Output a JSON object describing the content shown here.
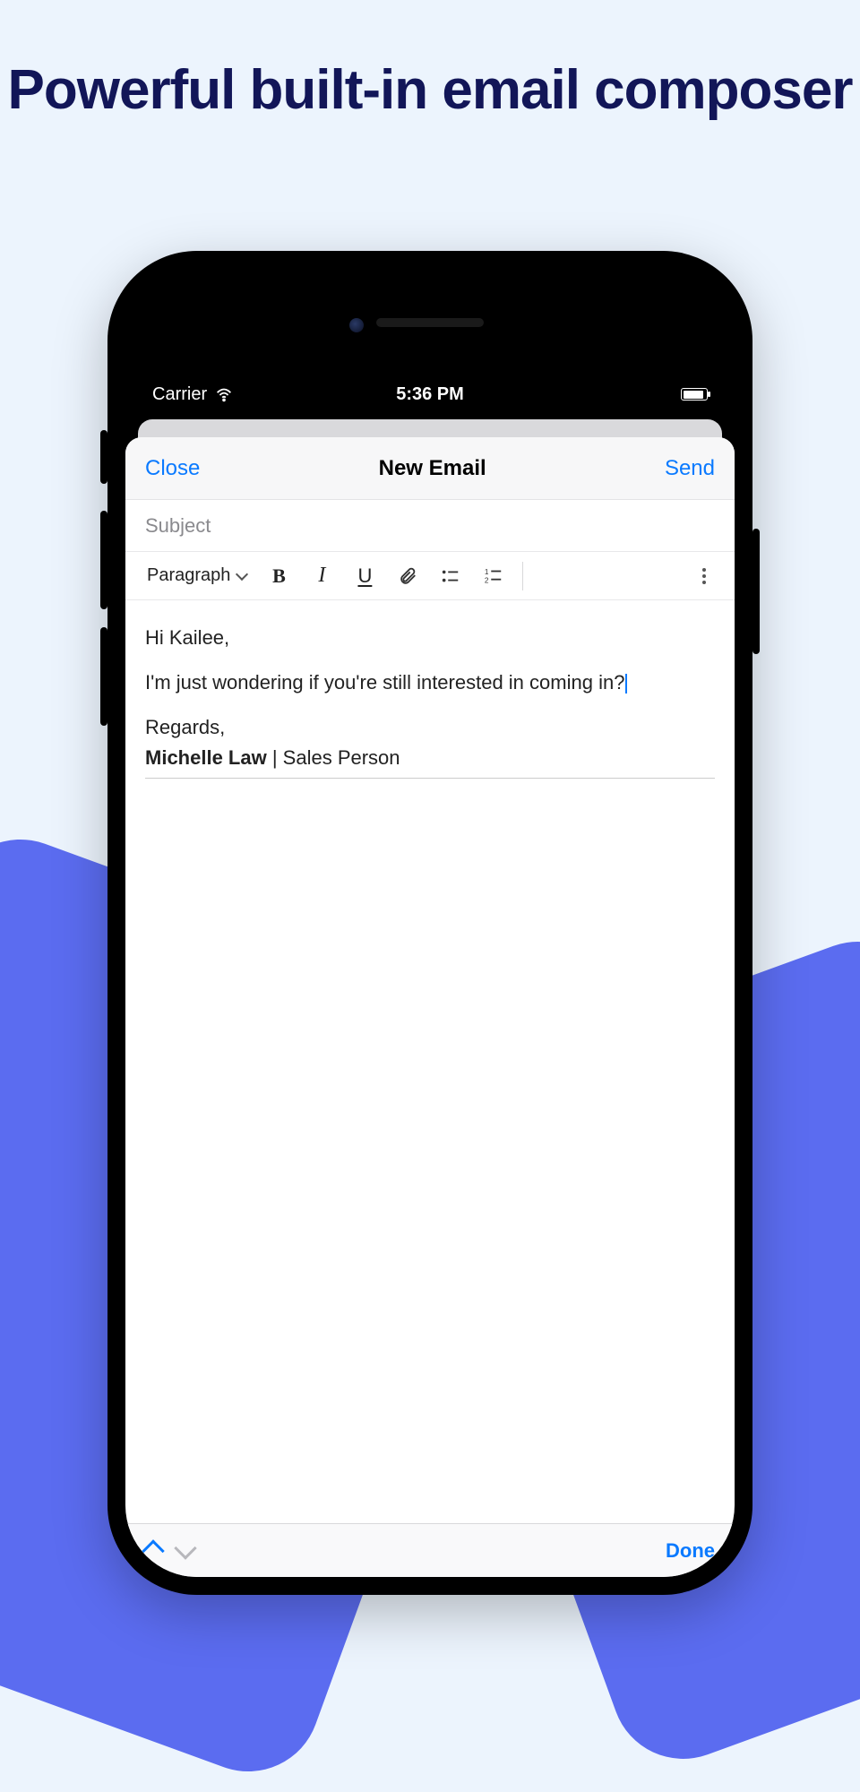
{
  "headline": "Powerful built-in email composer",
  "statusbar": {
    "carrier": "Carrier",
    "time": "5:36 PM"
  },
  "modal": {
    "close_label": "Close",
    "title": "New Email",
    "send_label": "Send",
    "subject_placeholder": "Subject",
    "subject_value": ""
  },
  "toolbar": {
    "paragraph_label": "Paragraph",
    "bold": "B",
    "italic": "I",
    "underline": "U"
  },
  "body": {
    "greeting": "Hi Kailee,",
    "line1": "I'm just wondering if you're still interested in coming in?",
    "regards": "Regards,",
    "sig_name": "Michelle Law",
    "sig_sep": " | ",
    "sig_title": "Sales Person"
  },
  "footer": {
    "done_label": "Done"
  }
}
